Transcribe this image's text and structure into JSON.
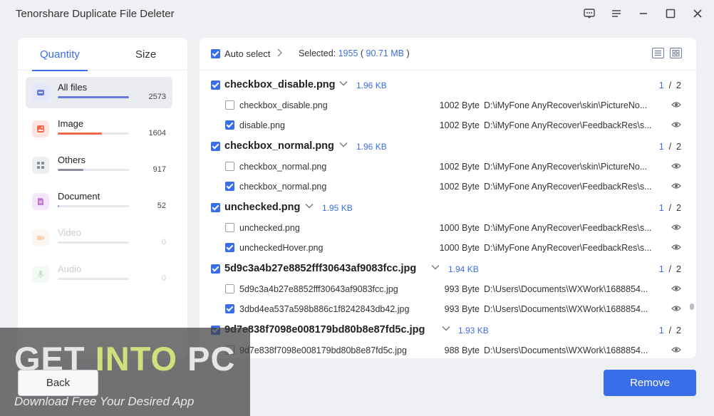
{
  "app": {
    "title": "Tenorshare Duplicate File Deleter"
  },
  "sidebar": {
    "tabs": [
      {
        "label": "Quantity"
      },
      {
        "label": "Size"
      }
    ],
    "categories": [
      {
        "label": "All files",
        "count": "2573",
        "fill": 1.0,
        "color": "#6a7ad8",
        "icon": "all-files-icon"
      },
      {
        "label": "Image",
        "count": "1604",
        "fill": 0.62,
        "color": "#f06a4a",
        "icon": "image-icon"
      },
      {
        "label": "Others",
        "count": "917",
        "fill": 0.36,
        "color": "#8a8f99",
        "icon": "others-icon"
      },
      {
        "label": "Document",
        "count": "52",
        "fill": 0.02,
        "color": "#c07ad8",
        "icon": "document-icon"
      },
      {
        "label": "Video",
        "count": "0",
        "fill": 0,
        "color": "#f0a060",
        "icon": "video-icon"
      },
      {
        "label": "Audio",
        "count": "0",
        "fill": 0,
        "color": "#7ac07a",
        "icon": "audio-icon"
      }
    ]
  },
  "toolbar": {
    "auto_select": "Auto select",
    "selected_label": "Selected: ",
    "selected_count": "1955",
    "selected_size": "90.71 MB",
    "paren_open": " ( ",
    "paren_close": " )"
  },
  "groups": [
    {
      "name": "checkbox_disable.png",
      "size": "1.96 KB",
      "page": "1",
      "total": "2",
      "items": [
        {
          "name": "checkbox_disable.png",
          "size": "1002 Byte",
          "path": "D:\\iMyFone AnyRecover\\skin\\PictureNo...",
          "checked": false
        },
        {
          "name": "disable.png",
          "size": "1002 Byte",
          "path": "D:\\iMyFone AnyRecover\\FeedbackRes\\s...",
          "checked": true
        }
      ]
    },
    {
      "name": "checkbox_normal.png",
      "size": "1.96 KB",
      "page": "1",
      "total": "2",
      "items": [
        {
          "name": "checkbox_normal.png",
          "size": "1002 Byte",
          "path": "D:\\iMyFone AnyRecover\\skin\\PictureNo...",
          "checked": false
        },
        {
          "name": "checkbox_normal.png",
          "size": "1002 Byte",
          "path": "D:\\iMyFone AnyRecover\\FeedbackRes\\s...",
          "checked": true
        }
      ]
    },
    {
      "name": "unchecked.png",
      "size": "1.95 KB",
      "page": "1",
      "total": "2",
      "items": [
        {
          "name": "unchecked.png",
          "size": "1000 Byte",
          "path": "D:\\iMyFone AnyRecover\\FeedbackRes\\s...",
          "checked": false
        },
        {
          "name": "uncheckedHover.png",
          "size": "1000 Byte",
          "path": "D:\\iMyFone AnyRecover\\FeedbackRes\\s...",
          "checked": true
        }
      ]
    },
    {
      "name": "5d9c3a4b27e8852fff30643af9083fcc.jpg",
      "size": "1.94 KB",
      "page": "1",
      "total": "2",
      "items": [
        {
          "name": "5d9c3a4b27e8852fff30643af9083fcc.jpg",
          "size": "993 Byte",
          "path": "D:\\Users\\Documents\\WXWork\\1688854...",
          "checked": false
        },
        {
          "name": "3dbd4ea537a598b886c1f8242843db42.jpg",
          "size": "993 Byte",
          "path": "D:\\Users\\Documents\\WXWork\\1688854...",
          "checked": true
        }
      ]
    },
    {
      "name": "9d7e838f7098e008179bd80b8e87fd5c.jpg",
      "size": "1.93 KB",
      "page": "1",
      "total": "2",
      "items": [
        {
          "name": "9d7e838f7098e008179bd80b8e87fd5c.jpg",
          "size": "988 Byte",
          "path": "D:\\Users\\Documents\\WXWork\\1688854...",
          "checked": false
        }
      ]
    }
  ],
  "buttons": {
    "back": "Back",
    "remove": "Remove"
  },
  "watermark": {
    "get": "GET ",
    "into": "INTO",
    "pc": " PC",
    "tagline": "Download Free Your Desired App"
  },
  "colors": {
    "accent": "#3a6ee8"
  }
}
